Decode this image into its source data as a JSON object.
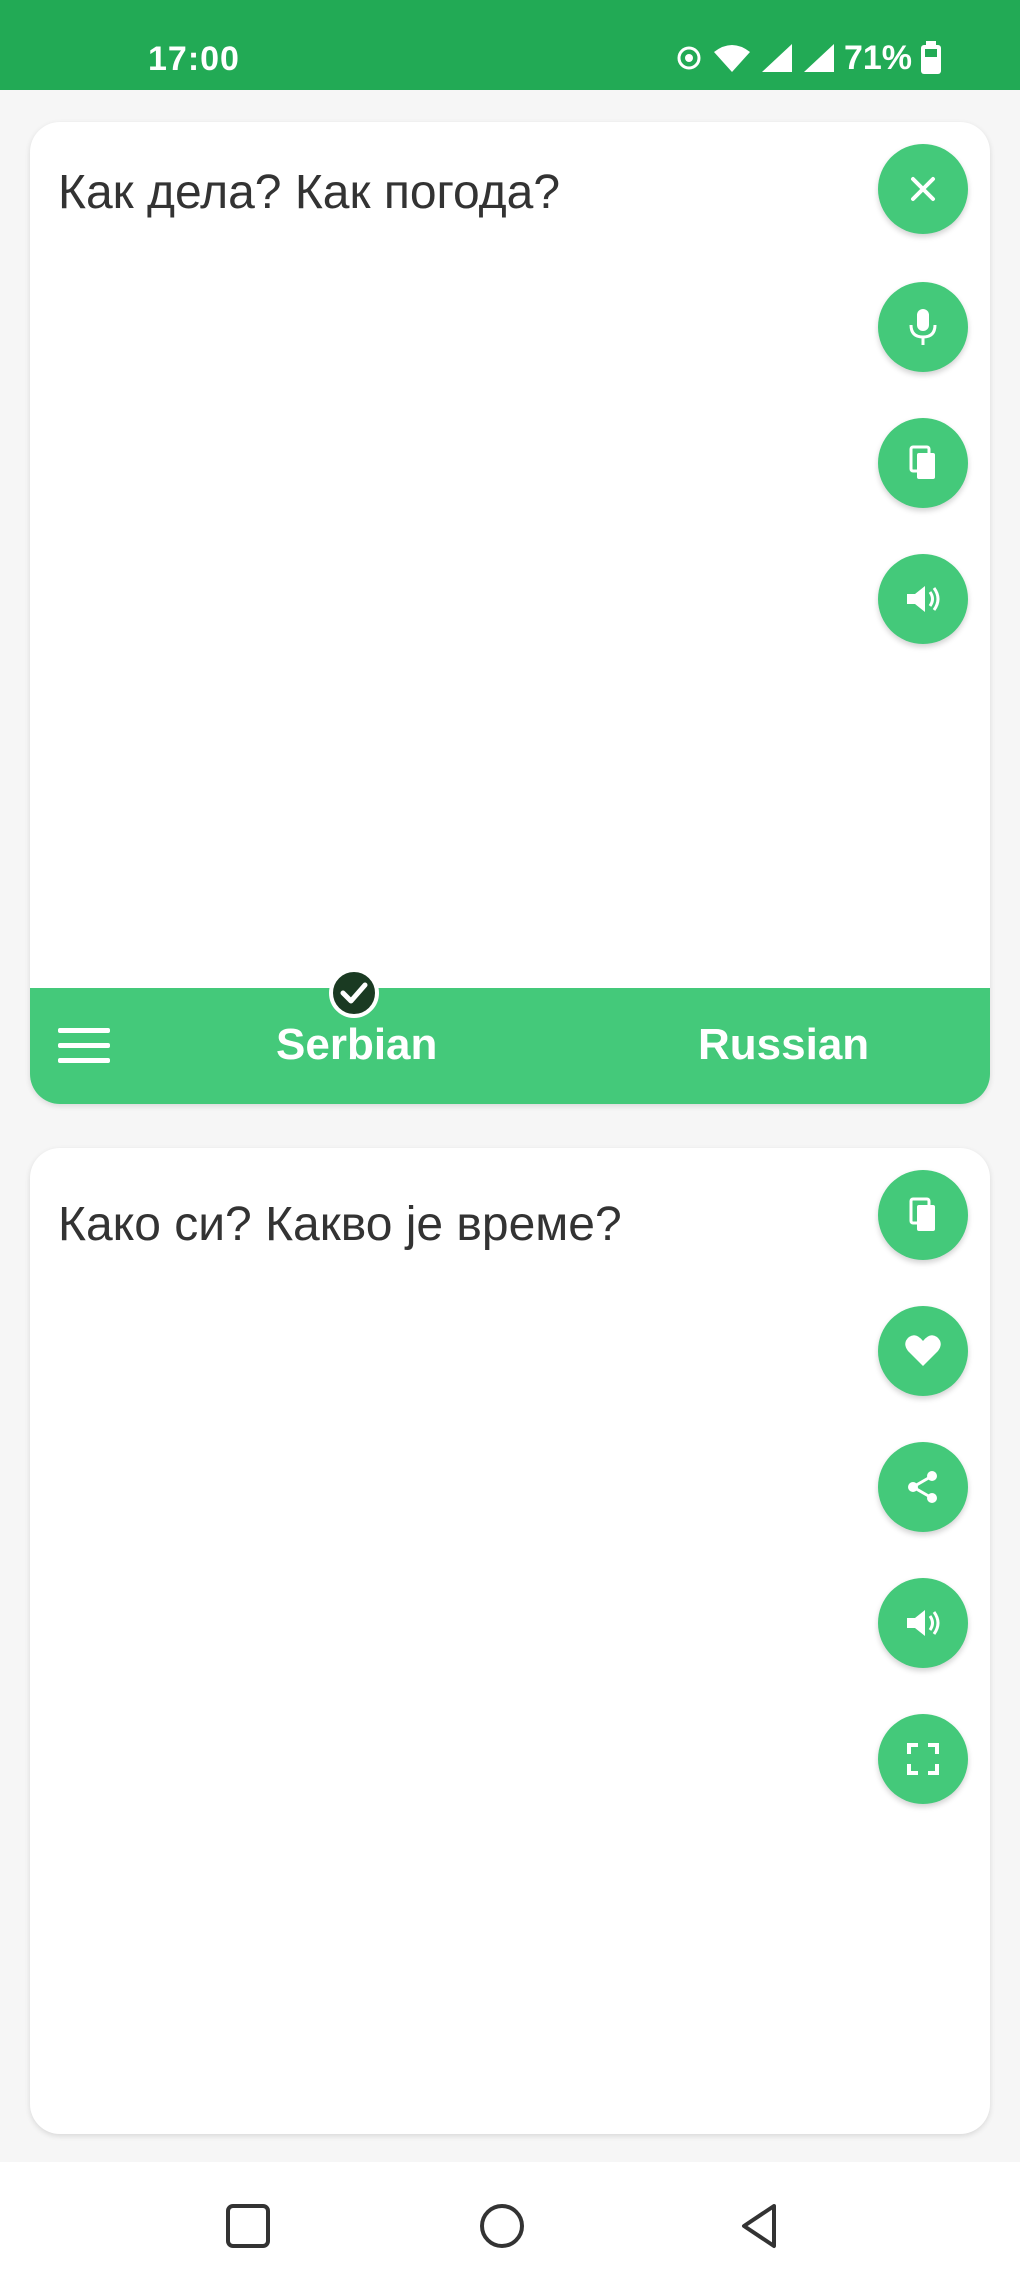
{
  "status_bar": {
    "time": "17:00",
    "battery_percent": "71%",
    "icons": [
      "hotspot-icon",
      "wifi-icon",
      "signal-icon",
      "signal-icon",
      "battery-icon"
    ]
  },
  "source_panel": {
    "text": "Как дела? Как погода?",
    "actions": [
      "close-icon",
      "microphone-icon",
      "copy-icon",
      "speaker-icon"
    ]
  },
  "language_bar": {
    "source_language": "Serbian",
    "target_language": "Russian",
    "selected": "Serbian"
  },
  "target_panel": {
    "text": "Како си? Какво је време?",
    "actions": [
      "copy-icon",
      "heart-icon",
      "share-icon",
      "speaker-icon",
      "fullscreen-icon"
    ]
  },
  "nav_bar": {
    "buttons": [
      "recent-apps-icon",
      "home-icon",
      "back-icon"
    ]
  },
  "colors": {
    "status_bar": "#22aa55",
    "accent": "#44c97a",
    "check_badge": "#1a3a22",
    "text": "#333333",
    "background": "#f6f6f6"
  }
}
